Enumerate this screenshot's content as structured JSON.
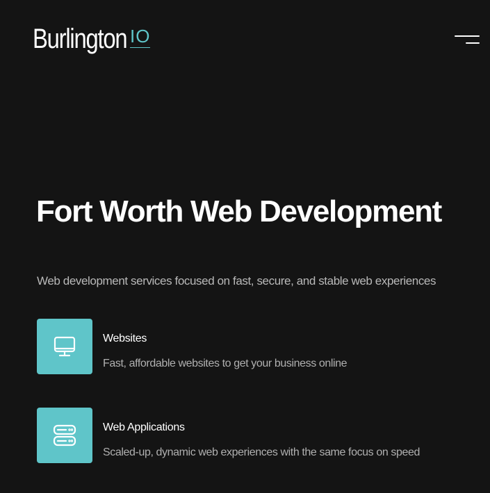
{
  "header": {
    "logo_text": "Burlington",
    "logo_suffix": "IO",
    "menu_icon": "hamburger-menu-icon"
  },
  "hero": {
    "title": "Fort Worth Web Development",
    "subtitle": "Web development services focused on fast, secure, and stable web experiences"
  },
  "services": [
    {
      "icon": "monitor-icon",
      "title": "Websites",
      "description": "Fast, affordable websites to get your business online"
    },
    {
      "icon": "server-icon",
      "title": "Web Applications",
      "description": "Scaled-up, dynamic web experiences with the same focus on speed"
    }
  ],
  "colors": {
    "background": "#141414",
    "accent": "#5fc5c9",
    "text_primary": "#ffffff",
    "text_secondary": "#b9b9b9"
  }
}
